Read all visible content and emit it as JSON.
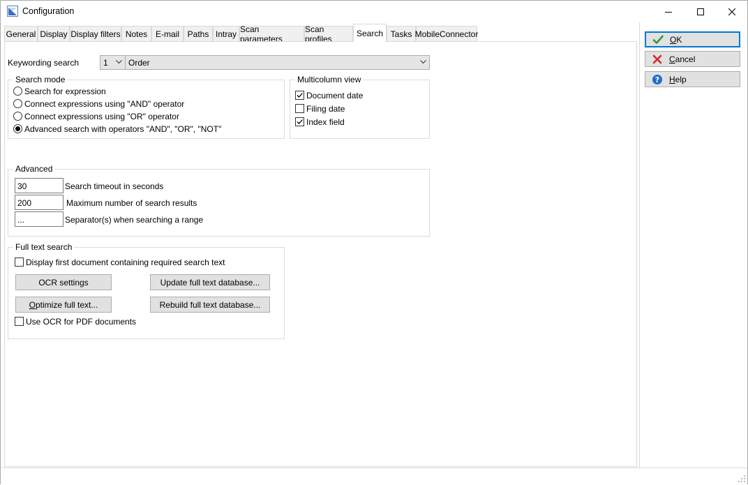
{
  "window": {
    "title": "Configuration"
  },
  "tabs": [
    {
      "label": "General"
    },
    {
      "label": "Display"
    },
    {
      "label": "Display filters"
    },
    {
      "label": "Notes"
    },
    {
      "label": "E-mail"
    },
    {
      "label": "Paths"
    },
    {
      "label": "Intray"
    },
    {
      "label": "Scan parameters"
    },
    {
      "label": "Scan profiles"
    },
    {
      "label": "Search",
      "active": true
    },
    {
      "label": "Tasks"
    },
    {
      "label": "MobileConnector"
    }
  ],
  "keywording": {
    "label": "Keywording search",
    "number_value": "1",
    "field_value": "Order"
  },
  "search_mode": {
    "title": "Search mode",
    "options": [
      {
        "label": "Search for expression",
        "selected": false
      },
      {
        "label": "Connect expressions using \"AND\" operator",
        "selected": false
      },
      {
        "label": "Connect expressions using \"OR\" operator",
        "selected": false
      },
      {
        "label": "Advanced search with operators \"AND\", \"OR\", \"NOT\"",
        "selected": true
      }
    ]
  },
  "multicolumn": {
    "title": "Multicolumn view",
    "options": [
      {
        "label": "Document date",
        "checked": true
      },
      {
        "label": "Filing date",
        "checked": false
      },
      {
        "label": "Index field",
        "checked": true
      }
    ]
  },
  "advanced": {
    "title": "Advanced",
    "timeout": {
      "value": "30",
      "label": "Search timeout in seconds"
    },
    "max_results": {
      "value": "200",
      "label": "Maximum number of search results"
    },
    "separator": {
      "value": "...",
      "label": "Separator(s) when searching a range"
    }
  },
  "fulltext": {
    "title": "Full text search",
    "display_first": {
      "label": "Display first document containing required search text",
      "checked": false
    },
    "ocr_settings_label": "OCR settings",
    "update_db_label": "Update full text database...",
    "optimize_label_u": "O",
    "optimize_label_rest": "ptimize full text...",
    "rebuild_db_label": "Rebuild full text database...",
    "use_ocr_pdf": {
      "label": "Use OCR for PDF documents",
      "checked": false
    }
  },
  "buttons": {
    "ok_u": "O",
    "ok_rest": "K",
    "cancel_u": "C",
    "cancel_rest": "ancel",
    "help_u": "H",
    "help_rest": "elp"
  },
  "colors": {
    "accent": "#0078d7",
    "ok_green": "#2e9b2e",
    "cancel_red": "#d9262e",
    "help_blue": "#1e6fc8"
  }
}
